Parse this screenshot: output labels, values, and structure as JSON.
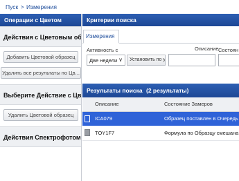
{
  "breadcrumb": {
    "root": "Пуск",
    "separator": ">",
    "current": "Измерения"
  },
  "left_panel": {
    "header": "Операции с Цветом",
    "section1_title": "Действия с Цветовым образ",
    "add_button": "Добавить Цветовой образец",
    "delete_all_button": "Удалить все результаты по Цв...",
    "section2_title": "Выберите Действие с Цвето",
    "delete_sample_button": "Удалить Цветовой образец",
    "section3_title": "Действия Спектрофотометр"
  },
  "search": {
    "header": "Критерии поиска",
    "tab": "Измерения",
    "activity_label": "Активность с",
    "activity_value": "Две недели",
    "set_default_button": "Установить по умол",
    "description_label": "Описание",
    "status_label": "Состоян"
  },
  "results": {
    "header": "Результаты поиска",
    "count_text": "(2 результаты)",
    "columns": {
      "description": "Описание",
      "status": "Состояние Замеров"
    },
    "rows": [
      {
        "description": "ICA079",
        "status": "Образец поставлен в Очередь"
      },
      {
        "description": "TOY1F7",
        "status": "Формула по Образцу смешана"
      }
    ]
  }
}
